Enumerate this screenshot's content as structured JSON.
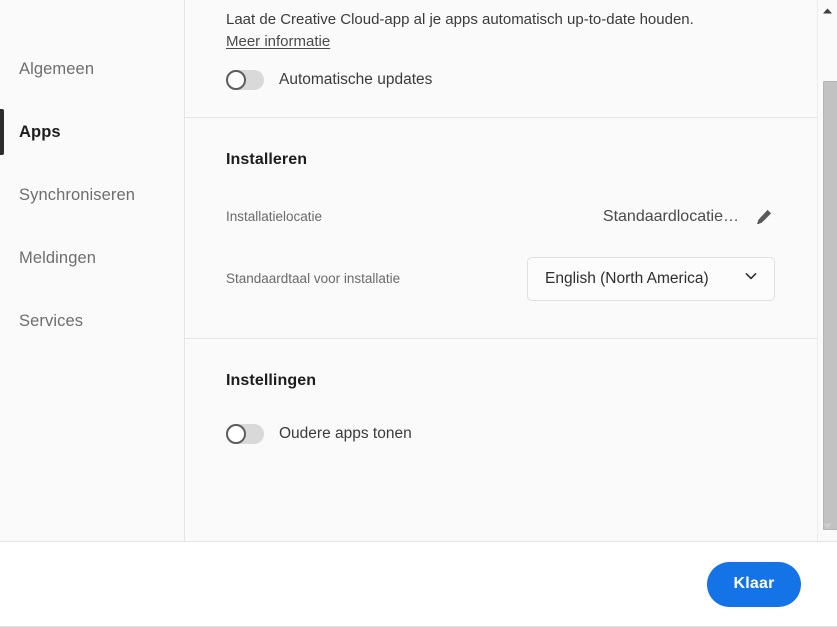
{
  "sidebar": {
    "items": [
      {
        "label": "Algemeen",
        "active": false
      },
      {
        "label": "Apps",
        "active": true
      },
      {
        "label": "Synchroniseren",
        "active": false
      },
      {
        "label": "Meldingen",
        "active": false
      },
      {
        "label": "Services",
        "active": false
      }
    ]
  },
  "updates_section": {
    "description": "Laat de Creative Cloud-app al je apps automatisch up-to-date houden.",
    "more_info_link": "Meer informatie",
    "toggle": {
      "label": "Automatische updates",
      "state": "off"
    }
  },
  "install_section": {
    "title": "Installeren",
    "location": {
      "label": "Installatielocatie",
      "value": "Standaardlocatie…",
      "edit_icon": "pencil-icon"
    },
    "language": {
      "label": "Standaardtaal voor installatie",
      "value": "English (North America)",
      "chevron_icon": "chevron-down-icon"
    }
  },
  "settings_section": {
    "title": "Instellingen",
    "toggle": {
      "label": "Oudere apps tonen",
      "state": "off"
    }
  },
  "scrollbar": {
    "up_icon": "triangle-up-icon",
    "down_icon": "triangle-down-icon"
  },
  "footer": {
    "done_label": "Klaar"
  },
  "colors": {
    "accent": "#1473e6",
    "selected_indicator": "#2c2c2c",
    "panel_bg": "#fafafa"
  }
}
